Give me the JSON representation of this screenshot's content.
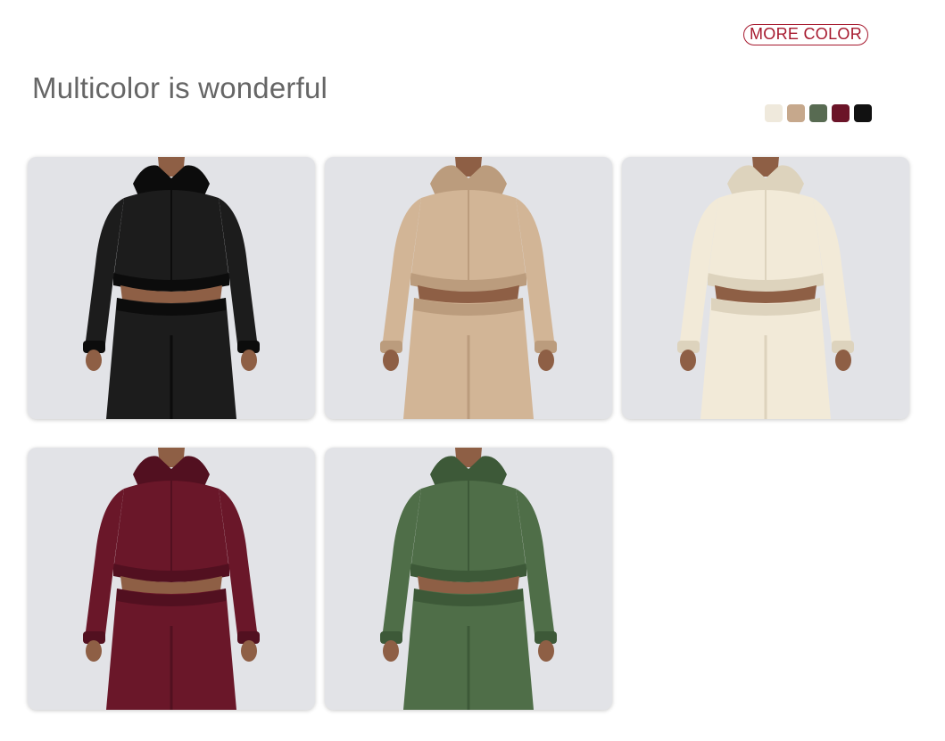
{
  "header": {
    "more_color_label": "MORE COLOR",
    "title": "Multicolor is wonderful"
  },
  "swatches": [
    {
      "name": "cream",
      "color": "#efe9dc"
    },
    {
      "name": "khaki",
      "color": "#c6a88c"
    },
    {
      "name": "army-green",
      "color": "#586b52"
    },
    {
      "name": "wine-red",
      "color": "#6b1428"
    },
    {
      "name": "black",
      "color": "#111111"
    }
  ],
  "products": [
    {
      "name": "black",
      "garment": "#1c1c1c",
      "shade": "#0c0c0c",
      "skin": "#8e5f45"
    },
    {
      "name": "khaki",
      "garment": "#d2b596",
      "shade": "#bb9c7d",
      "skin": "#8e5f45"
    },
    {
      "name": "cream",
      "garment": "#f2ead8",
      "shade": "#ddd3bd",
      "skin": "#8e5f45"
    },
    {
      "name": "wine-red",
      "garment": "#6a1729",
      "shade": "#521020",
      "skin": "#8e5f45"
    },
    {
      "name": "army-green",
      "garment": "#4f6e48",
      "shade": "#3d5938",
      "skin": "#8e5f45"
    }
  ]
}
